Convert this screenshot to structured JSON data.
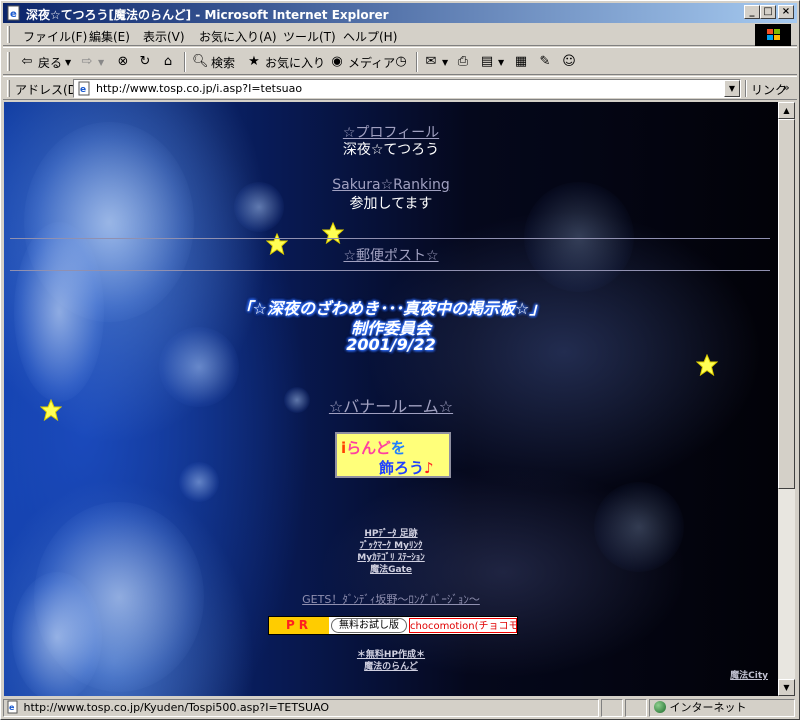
{
  "window": {
    "title": "深夜☆てつろう[魔法のらんど] - Microsoft Internet Explorer",
    "controls": {
      "minimize": "_",
      "maximize": "□",
      "close": "×"
    }
  },
  "menubar": {
    "items": [
      "ファイル(F)",
      "編集(E)",
      "表示(V)",
      "お気に入り(A)",
      "ツール(T)",
      "ヘルプ(H)"
    ]
  },
  "toolbar": {
    "back": "戻る",
    "search": "検索",
    "favorites": "お気に入り",
    "media": "メディア"
  },
  "addressbar": {
    "label": "アドレス(D)",
    "url": "http://www.tosp.co.jp/i.asp?I=tetsuao",
    "links": "リンク"
  },
  "page": {
    "profile_link": "☆プロフィール",
    "author_name": "深夜☆てつろう",
    "ranking_link": "Sakura☆Ranking",
    "ranking_note": "参加してます",
    "mail_link": "☆郵便ポスト☆",
    "bbs_title": "「☆深夜のざわめき･･･真夜中の掲示板☆」",
    "bbs_committee": "制作委員会",
    "bbs_date": "2001/9/22",
    "banner_link": "☆バナールーム☆",
    "iland_banner": {
      "line1_a": "i",
      "line1_b": "らんど",
      "line1_c": "を",
      "line2_a": "飾ろう",
      "line2_b": "♪"
    },
    "small_links": [
      "HPﾃﾞｰﾀ 足跡",
      "ﾌﾞｯｸﾏｰｸ Myﾘﾝｸ",
      "Myｶﾃｺﾞﾘ ｽﾃｰｼｮﾝ",
      "魔法Gate"
    ],
    "gets_link": "GETS！ﾀﾞﾝﾃﾞｨ坂野～ﾛﾝｸﾞﾊﾞｰｼﾞｮﾝ～",
    "pr": {
      "label": "PR",
      "trial": "無料お試し版",
      "ad": "chocomotion(チョコモ"
    },
    "free_hp_link": "＊無料HP作成＊",
    "mahou_land_link": "魔法のらんど",
    "corner_link": "魔法City"
  },
  "statusbar": {
    "url": "http://www.tosp.co.jp/Kyuden/Tospi500.asp?I=TETSUAO",
    "zone": "インターネット"
  }
}
